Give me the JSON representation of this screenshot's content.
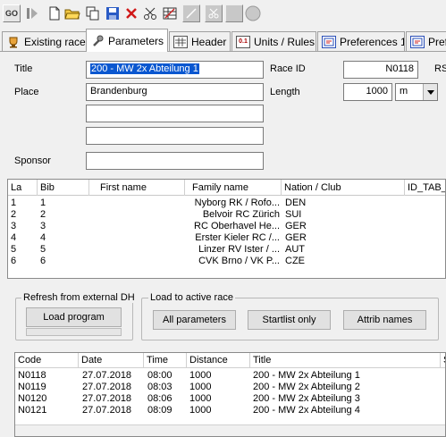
{
  "tabs": [
    {
      "label": "Existing races",
      "icon": "trophy-icon"
    },
    {
      "label": "Parameters",
      "icon": "wrench-icon"
    },
    {
      "label": "Header",
      "icon": "grid-icon"
    },
    {
      "label": "Units / Rules",
      "icon": "ruler-icon"
    },
    {
      "label": "Preferences 1",
      "icon": "preferences-icon"
    },
    {
      "label": "Pref",
      "icon": "preferences-icon"
    }
  ],
  "form": {
    "title_label": "Title",
    "title_value": "200 - MW 2x Abteilung 1",
    "place_label": "Place",
    "place_value": "Brandenburg",
    "sponsor_label": "Sponsor",
    "race_id_label": "Race ID",
    "race_id_value": "N0118",
    "rs_label": "RS",
    "length_label": "Length",
    "length_value": "1000",
    "length_unit": "m"
  },
  "grid": {
    "columns": [
      "La",
      "Bib",
      "First name",
      "Family name",
      "Nation / Club",
      "ID_TAB_"
    ],
    "rows": [
      {
        "lane": "1",
        "bib": "1",
        "first": "",
        "family": "Nyborg RK / Rofo...",
        "nation": "DEN"
      },
      {
        "lane": "2",
        "bib": "2",
        "first": "",
        "family": "Belvoir RC Zürich",
        "nation": "SUI"
      },
      {
        "lane": "3",
        "bib": "3",
        "first": "",
        "family": "RC Oberhavel He...",
        "nation": "GER"
      },
      {
        "lane": "4",
        "bib": "4",
        "first": "",
        "family": "Erster Kieler RC /...",
        "nation": "GER"
      },
      {
        "lane": "5",
        "bib": "5",
        "first": "",
        "family": "Linzer RV Ister / ...",
        "nation": "AUT"
      },
      {
        "lane": "6",
        "bib": "6",
        "first": "",
        "family": "CVK Brno / VK P...",
        "nation": "CZE"
      }
    ]
  },
  "refresh": {
    "group_title": "Refresh from external DH",
    "load_program": "Load program"
  },
  "load_active": {
    "group_title": "Load to active race",
    "all_parameters": "All parameters",
    "startlist_only": "Startlist only",
    "attrib_names": "Attrib names"
  },
  "races": {
    "columns": [
      "Code",
      "Date",
      "Time",
      "Distance",
      "Title",
      "S"
    ],
    "rows": [
      {
        "code": "N0118",
        "date": "27.07.2018",
        "time": "08:00",
        "distance": "1000",
        "title": "200 - MW 2x Abteilung 1"
      },
      {
        "code": "N0119",
        "date": "27.07.2018",
        "time": "08:03",
        "distance": "1000",
        "title": "200 - MW 2x Abteilung 2"
      },
      {
        "code": "N0120",
        "date": "27.07.2018",
        "time": "08:06",
        "distance": "1000",
        "title": "200 - MW 2x Abteilung 3"
      },
      {
        "code": "N0121",
        "date": "27.07.2018",
        "time": "08:09",
        "distance": "1000",
        "title": "200 - MW 2x Abteilung 4"
      }
    ]
  },
  "toolbar": [
    {
      "name": "go-icon",
      "label": "GO"
    },
    {
      "name": "play-icon"
    },
    {
      "name": "new-document-icon"
    },
    {
      "name": "open-folder-icon"
    },
    {
      "name": "copy-icon"
    },
    {
      "name": "save-icon"
    },
    {
      "name": "delete-icon"
    },
    {
      "name": "scissors-icon"
    },
    {
      "name": "table-icon"
    },
    {
      "name": "disabled-icon"
    },
    {
      "name": "disabled-scissors-icon"
    },
    {
      "name": "stop-icon"
    },
    {
      "name": "record-icon"
    }
  ]
}
